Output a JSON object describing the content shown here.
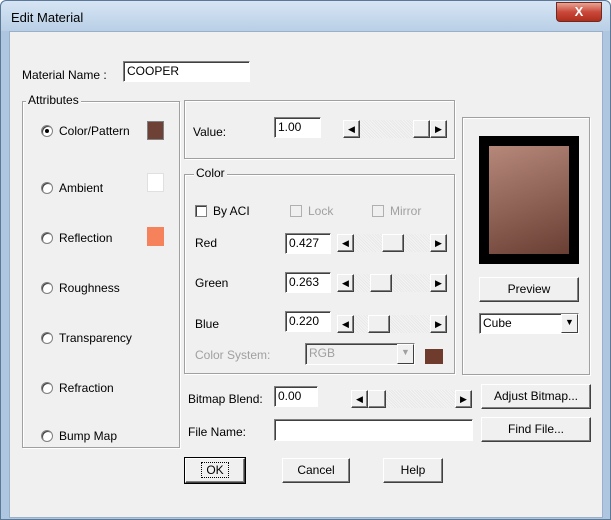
{
  "window": {
    "title": "Edit Material",
    "close_glyph": "X"
  },
  "material_name": {
    "label": "Material Name :",
    "value": "COOPER"
  },
  "attributes": {
    "caption": "Attributes",
    "items": [
      {
        "label": "Color/Pattern",
        "selected": true,
        "swatch": "#6e4136"
      },
      {
        "label": "Ambient",
        "selected": false,
        "swatch": "#ffffff"
      },
      {
        "label": "Reflection",
        "selected": false,
        "swatch": "#f5825a"
      },
      {
        "label": "Roughness",
        "selected": false
      },
      {
        "label": "Transparency",
        "selected": false
      },
      {
        "label": "Refraction",
        "selected": false
      },
      {
        "label": "Bump Map",
        "selected": false
      }
    ]
  },
  "value": {
    "label": "Value:",
    "value": "1.00"
  },
  "color": {
    "caption": "Color",
    "by_aci_label": "By ACI",
    "lock_label": "Lock",
    "mirror_label": "Mirror",
    "red": {
      "label": "Red",
      "value": "0.427",
      "fraction": 0.427
    },
    "green": {
      "label": "Green",
      "value": "0.263",
      "fraction": 0.263
    },
    "blue": {
      "label": "Blue",
      "value": "0.220",
      "fraction": 0.22
    },
    "color_system_label": "Color System:",
    "color_system_value": "RGB",
    "current_color": "#6e3b2c"
  },
  "preview": {
    "button_label": "Preview",
    "shape_value": "Cube",
    "color_light": "#b5887a",
    "color_dark": "#6a3f33"
  },
  "bitmap_blend": {
    "label": "Bitmap Blend:",
    "value": "0.00"
  },
  "file_name": {
    "label": "File Name:",
    "value": ""
  },
  "buttons": {
    "adjust_bitmap": "Adjust Bitmap...",
    "find_file": "Find File...",
    "ok": "OK",
    "cancel": "Cancel",
    "help": "Help"
  },
  "icons": {
    "arrow_left": "◀",
    "arrow_right": "▶",
    "dropdown": "▼"
  }
}
